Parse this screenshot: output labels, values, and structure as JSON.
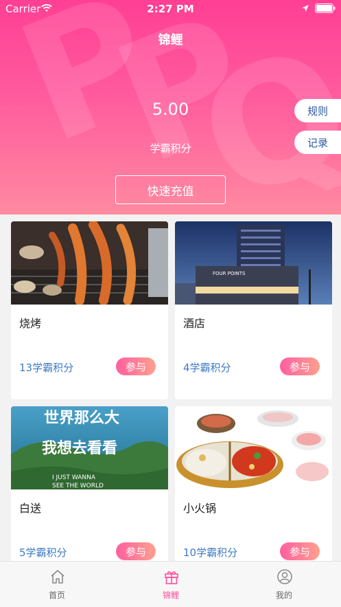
{
  "status_bar": {
    "carrier": "Carrier",
    "time": "2:27 PM"
  },
  "header": {
    "title": "锦鲤",
    "points_value": "5.00",
    "points_label": "学霸积分",
    "recharge_label": "快速充值",
    "rules_label": "规则",
    "records_label": "记录"
  },
  "items": [
    {
      "name": "烧烤",
      "points": "13学霸积分",
      "join_label": "参与",
      "image": "bbq-photo"
    },
    {
      "name": "酒店",
      "points": "4学霸积分",
      "join_label": "参与",
      "image": "hotel-photo"
    },
    {
      "name": "白送",
      "points": "5学霸积分",
      "join_label": "参与",
      "image": "travel-photo"
    },
    {
      "name": "小火锅",
      "points": "10学霸积分",
      "join_label": "参与",
      "image": "hotpot-photo"
    }
  ],
  "travel_image_text": {
    "line1": "世界那么大",
    "line2": "我想去看看",
    "line3": "I JUST WANNA",
    "line4": "SEE THE WORLD"
  },
  "hotel_sign_text": "FOUR POINTS",
  "tabs": [
    {
      "label": "首页",
      "icon": "home-icon",
      "active": false
    },
    {
      "label": "锦鲤",
      "icon": "gift-icon",
      "active": true
    },
    {
      "label": "我的",
      "icon": "user-icon",
      "active": false
    }
  ],
  "colors": {
    "accent": "#ff4f9a",
    "link_blue": "#3d7ac4"
  }
}
